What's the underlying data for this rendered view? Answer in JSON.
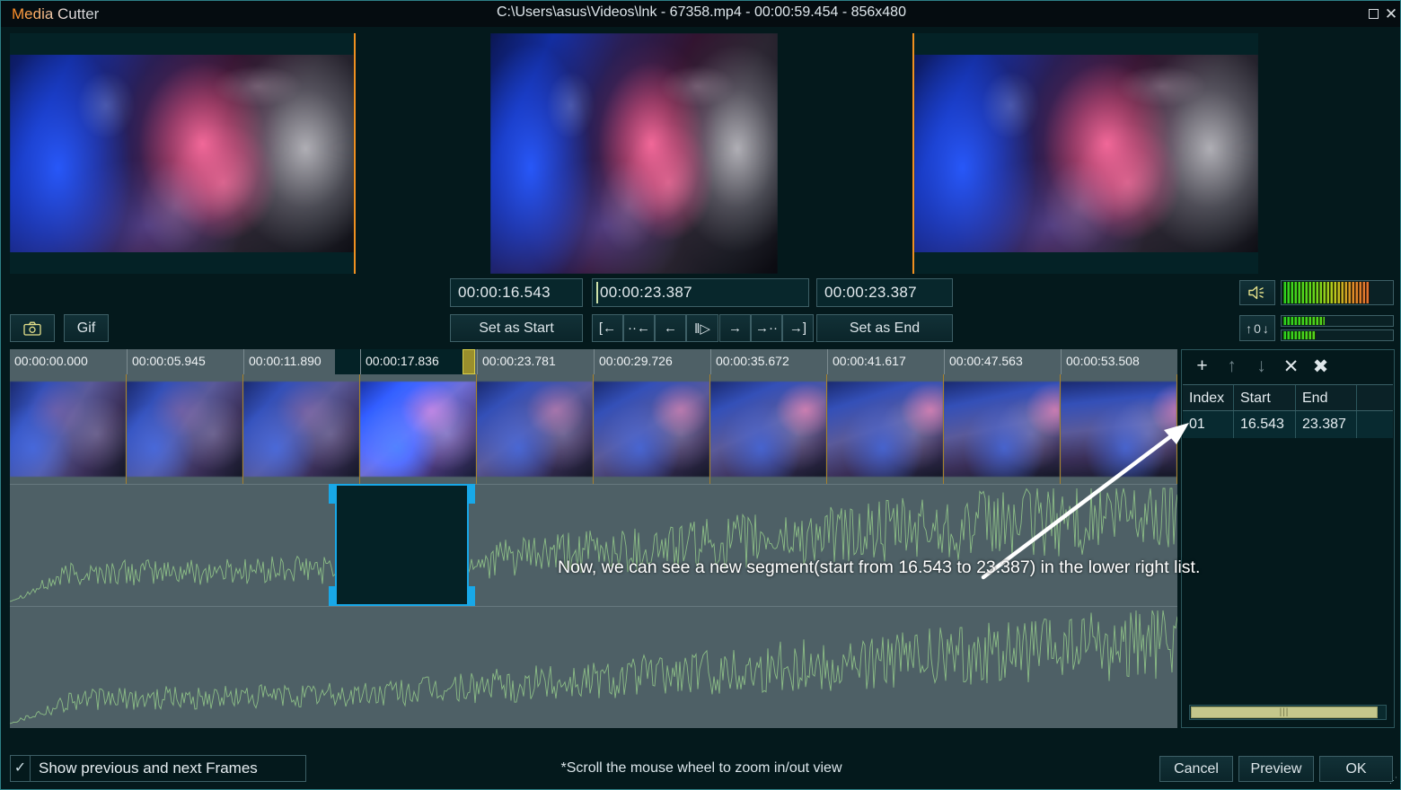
{
  "window": {
    "app_title": "Media Cutter",
    "document_title": "C:\\Users\\asus\\Videos\\lnk - 67358.mp4 - 00:00:59.454 - 856x480",
    "maximize_icon": "maximize-icon",
    "close_icon": "close-icon"
  },
  "toolbar": {
    "snapshot_icon": "camera-icon",
    "gif_label": "Gif"
  },
  "transport": {
    "start_time": "00:00:16.543",
    "current_time": "00:00:23.387",
    "end_time": "00:00:23.387",
    "set_start_label": "Set as Start",
    "set_end_label": "Set as End",
    "nav_buttons": [
      {
        "label": "[←",
        "name": "jump-to-start-button"
      },
      {
        "label": "··←",
        "name": "step-back-fast-button"
      },
      {
        "label": "←",
        "name": "step-back-button"
      },
      {
        "label": "‖▷",
        "name": "play-pause-button"
      },
      {
        "label": "→",
        "name": "step-forward-button"
      },
      {
        "label": "→··",
        "name": "step-forward-fast-button"
      },
      {
        "label": "→]",
        "name": "jump-to-end-button"
      }
    ]
  },
  "audio": {
    "speaker_icon": "speaker-icon",
    "volume_percent": 78,
    "stepper_value": "0",
    "stepper_up_icon": "arrow-up-icon",
    "stepper_down_icon": "arrow-down-icon",
    "meter_left_percent": 38,
    "meter_right_percent": 30
  },
  "timeline": {
    "ruler_labels": [
      "00:00:00.000",
      "00:00:05.945",
      "00:00:11.890",
      "00:00:17.836",
      "00:00:23.781",
      "00:00:29.726",
      "00:00:35.672",
      "00:00:41.617",
      "00:00:47.563",
      "00:00:53.508"
    ],
    "playhead_time": "00:00:23.387",
    "selection_start": "16.543",
    "selection_end": "23.387"
  },
  "segments": {
    "tools": [
      {
        "label": "+",
        "name": "add-segment-button"
      },
      {
        "label": "↑",
        "name": "move-segment-up-button"
      },
      {
        "label": "↓",
        "name": "move-segment-down-button"
      },
      {
        "label": "✕",
        "name": "delete-segment-button"
      },
      {
        "label": "✖",
        "name": "delete-all-segments-button"
      }
    ],
    "columns": [
      "Index",
      "Start",
      "End"
    ],
    "rows": [
      {
        "index": "01",
        "start": "16.543",
        "end": "23.387"
      }
    ],
    "scroll_grip": "|||"
  },
  "annotation": {
    "text": "Now, we can see a new segment(start from 16.543 to 23.387) in the lower right list.",
    "arrow": "arrow-pointing-to-segment-row"
  },
  "footer": {
    "show_frames_checked": "✓",
    "show_frames_label": "Show previous and next Frames",
    "hint": "*Scroll the mouse wheel to zoom in/out view",
    "cancel_label": "Cancel",
    "preview_label": "Preview",
    "ok_label": "OK",
    "resize_grip": "⋰"
  },
  "colors": {
    "accent_orange": "#f09020",
    "selection_blue": "#18a8e8",
    "playhead_yellow": "#d8cf48",
    "panel_bg": "#04191c",
    "timeline_bg": "#4e6066",
    "waveform_green": "#8cbd86"
  }
}
